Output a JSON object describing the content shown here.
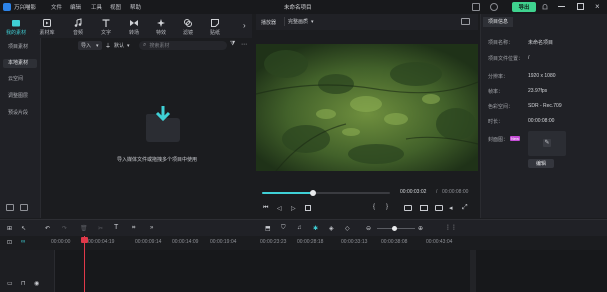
{
  "app": {
    "name": "万兴喵影",
    "menu": [
      "文件",
      "编辑",
      "工具",
      "视图",
      "帮助"
    ],
    "project_title": "未命名项目",
    "export_label": "导出",
    "brand_color": "#3fd0d6",
    "export_color": "#3fd38f"
  },
  "toolbar": {
    "items": [
      {
        "label": "我的素材",
        "icon": "folder-media-icon",
        "active": true
      },
      {
        "label": "素材库",
        "icon": "library-icon",
        "active": false
      },
      {
        "label": "音频",
        "icon": "music-note-icon",
        "active": false
      },
      {
        "label": "文字",
        "icon": "text-t-icon",
        "active": false
      },
      {
        "label": "转场",
        "icon": "transition-icon",
        "active": false
      },
      {
        "label": "特效",
        "icon": "sparkle-effects-icon",
        "active": false
      },
      {
        "label": "滤镜",
        "icon": "filter-icon",
        "active": false
      },
      {
        "label": "贴纸",
        "icon": "sticker-icon",
        "active": false
      }
    ]
  },
  "sidebar": {
    "items": [
      {
        "label": "项目素材",
        "active": false
      },
      {
        "label": "本地素材",
        "active": true
      },
      {
        "label": "云空间",
        "active": false
      },
      {
        "label": "调整图层",
        "active": false
      },
      {
        "label": "预设片段",
        "active": false
      }
    ]
  },
  "media": {
    "import_label": "导入",
    "default_label": "默认",
    "search_placeholder": "搜索素材",
    "empty_hint": "导入媒体文件或拖拽多个项目中使用"
  },
  "preview": {
    "tab_player": "播放器",
    "quality": "完整画质",
    "current_time": "00:00:03:02",
    "total_time": "00:00:08:00",
    "progress": 0.4
  },
  "properties": {
    "tab": "项目信息",
    "rows": [
      {
        "label": "项目名称：",
        "value": "未命名项目"
      },
      {
        "label": "项目文件位置：",
        "value": "/"
      },
      {
        "label": "分辨率：",
        "value": "1920 x 1080"
      },
      {
        "label": "帧率：",
        "value": "23.97fps"
      },
      {
        "label": "色彩空间：",
        "value": "SDR - Rec.709"
      },
      {
        "label": "时长：",
        "value": "00:00:08:00"
      }
    ],
    "cover_label": "封面图：",
    "new_badge": "New",
    "edit_button": "编辑"
  },
  "timeline": {
    "ticks": [
      "00:00:00",
      "00:00:04:19",
      "00:00:09:14",
      "00:00:14:09",
      "00:00:19:04",
      "00:00:23:23",
      "00:00:28:18",
      "00:00:33:13",
      "00:00:38:08",
      "00:00:43:04"
    ],
    "playhead_color": "#e0394a"
  }
}
